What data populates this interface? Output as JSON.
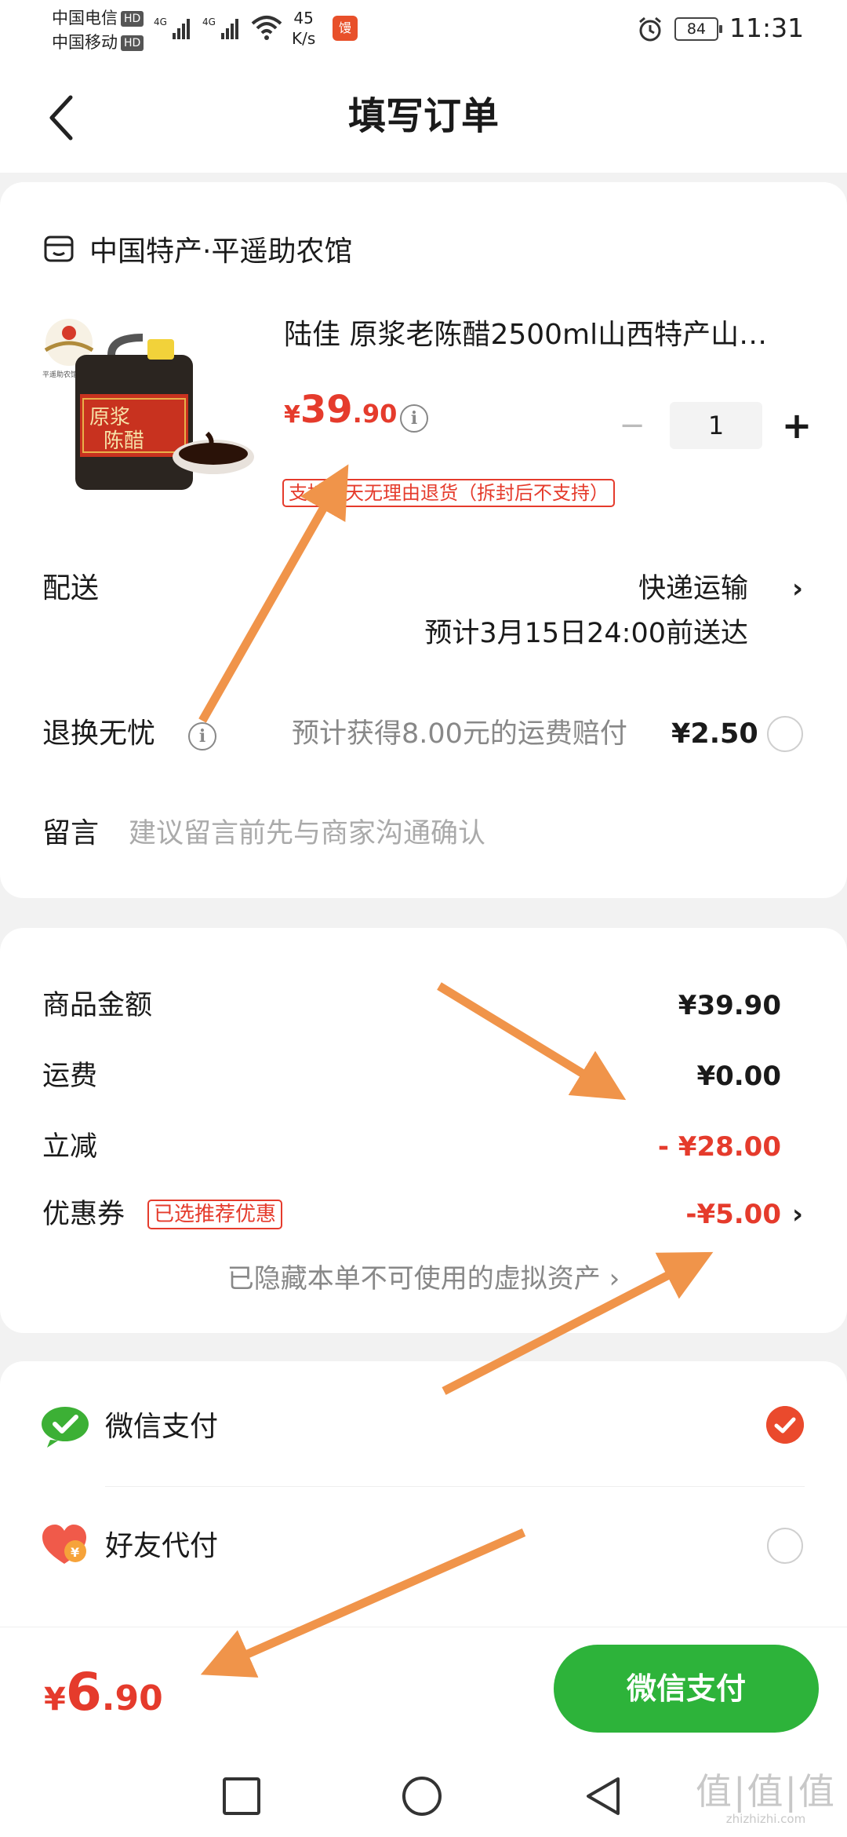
{
  "status_bar": {
    "carrier1": "中国电信",
    "carrier2": "中国移动",
    "hd": "HD",
    "network": "4G",
    "speed_value": "45",
    "speed_unit": "K/s",
    "app_icon_text": "馒",
    "battery": "84",
    "time": "11:31"
  },
  "header": {
    "title": "填写订单"
  },
  "store": {
    "name": "中国特产·平遥助农馆"
  },
  "product": {
    "title": "陆佳 原浆老陈醋2500ml山西特产山…",
    "price_yen": "¥",
    "price_int": "39",
    "price_dec": ".90",
    "quantity": "1",
    "minus": "−",
    "plus": "+",
    "return_tag": "支持七天无理由退货（拆封后不支持）",
    "image_label_top": "原浆",
    "image_label_bottom": "陈醋",
    "image_brand_text": "平遥助农馆"
  },
  "delivery": {
    "label": "配送",
    "method": "快递运输",
    "eta": "预计3月15日24:00前送达"
  },
  "worry_free": {
    "label": "退换无忧",
    "text": "预计获得8.00元的运费赔付",
    "price": "¥2.50"
  },
  "message": {
    "label": "留言",
    "placeholder": "建议留言前先与商家沟通确认"
  },
  "fees": {
    "goods_label": "商品金额",
    "goods_value": "¥39.90",
    "shipping_label": "运费",
    "shipping_value": "¥0.00",
    "discount_label": "立减",
    "discount_value": "- ¥28.00",
    "coupon_label": "优惠券",
    "coupon_tag": "已选推荐优惠",
    "coupon_value": "-¥5.00",
    "hidden_assets": "已隐藏本单不可使用的虚拟资产 ›"
  },
  "payment": {
    "wechat": "微信支付",
    "friend": "好友代付",
    "selected": "wechat"
  },
  "bottom": {
    "total_yen": "¥",
    "total_int": "6",
    "total_dec": ".90",
    "pay_button": "微信支付"
  },
  "watermark": {
    "big": "值|值|值",
    "small": "zhizhizhi.com"
  },
  "colors": {
    "price_red": "#e53b2c",
    "pay_green": "#2db33a",
    "wechat_green": "#3cb035",
    "annotation_orange": "#f0944a",
    "check_red": "#ea4a2d"
  }
}
